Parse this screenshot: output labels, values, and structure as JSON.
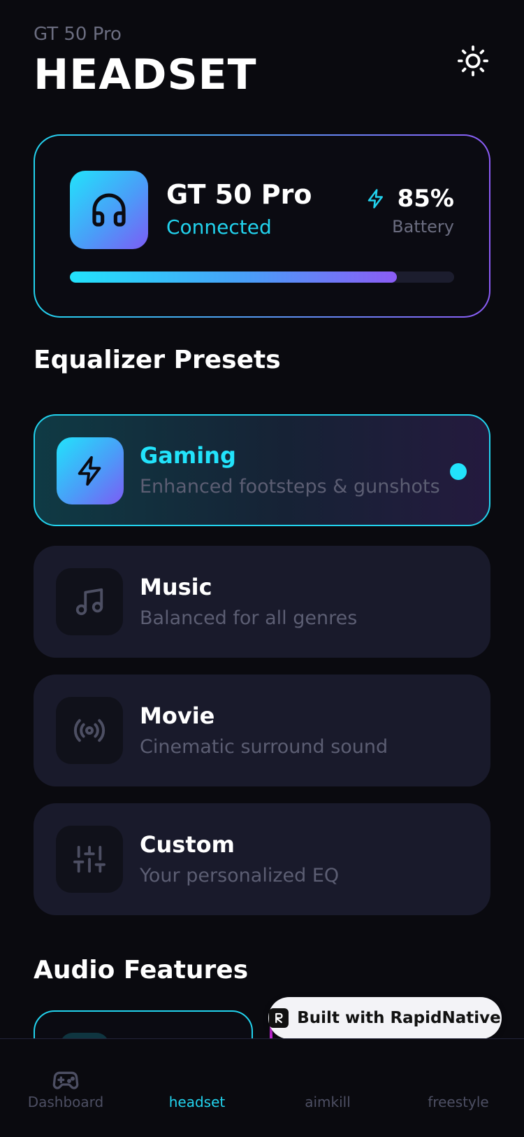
{
  "header": {
    "subtitle": "GT 50 Pro",
    "title": "HEADSET",
    "settings_icon": "sun-icon"
  },
  "device": {
    "name": "GT 50 Pro",
    "status": "Connected",
    "icon": "headphones-icon",
    "battery_percent": "85%",
    "battery_level": 0.85,
    "battery_label": "Battery",
    "battery_icon": "lightning-icon"
  },
  "equalizer": {
    "title": "Equalizer Presets",
    "presets": [
      {
        "name": "Gaming",
        "description": "Enhanced footsteps & gunshots",
        "icon": "lightning-icon",
        "active": true
      },
      {
        "name": "Music",
        "description": "Balanced for all genres",
        "icon": "music-note-icon",
        "active": false
      },
      {
        "name": "Movie",
        "description": "Cinematic surround sound",
        "icon": "broadcast-icon",
        "active": false
      },
      {
        "name": "Custom",
        "description": "Your personalized EQ",
        "icon": "sliders-icon",
        "active": false
      }
    ]
  },
  "audio_features": {
    "title": "Audio Features"
  },
  "badge": {
    "text": "Built with RapidNative"
  },
  "nav": {
    "items": [
      {
        "label": "Dashboard",
        "icon": "gamepad-icon",
        "active": false
      },
      {
        "label": "headset",
        "icon": "",
        "active": true
      },
      {
        "label": "aimkill",
        "icon": "",
        "active": false
      },
      {
        "label": "freestyle",
        "icon": "",
        "active": false
      }
    ]
  },
  "colors": {
    "accent": "#22d3ee",
    "accent_purple": "#8b5cf6",
    "background": "#0a0a0f",
    "card": "#191a2b"
  }
}
